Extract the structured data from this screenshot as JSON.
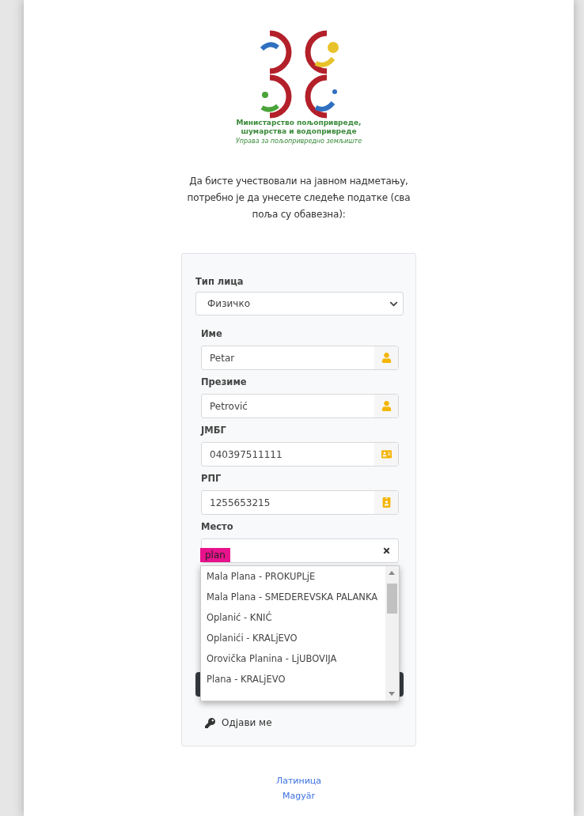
{
  "logo": {
    "lines": [
      "Министарство пољопривреде,",
      "шумарства и водопривреде"
    ],
    "subtitle": "Управа за пољопривредно земљиште"
  },
  "intro": "Да бисте учествовали на јавном надметању, потребно је да унесете следеће податке (сва поља су обавезна):",
  "form": {
    "person_type": {
      "label": "Тип лица",
      "value": "Физичко"
    },
    "fields": [
      {
        "label": "Име",
        "value": "Petar",
        "kind": "user"
      },
      {
        "label": "Презиме",
        "value": "Petrović",
        "kind": "user"
      },
      {
        "label": "ЈМБГ",
        "value": "040397511111",
        "kind": "card"
      },
      {
        "label": "РПГ",
        "value": "1255653215",
        "kind": "badge"
      }
    ],
    "place": {
      "label": "Место",
      "value": "plan",
      "highlighted": true,
      "suggestions": [
        "Mala Plana - PROKUPLjE",
        "Mala Plana - SMEDEREVSKA PALANKA",
        "Oplanić - KNIĆ",
        "Oplanići - KRALjEVO",
        "Orovička Planina - LjUBOVIJA",
        "Plana - KRALjEVO"
      ]
    },
    "logout": "Одјави ме"
  },
  "languages": [
    "Латиница",
    "Magyär"
  ]
}
